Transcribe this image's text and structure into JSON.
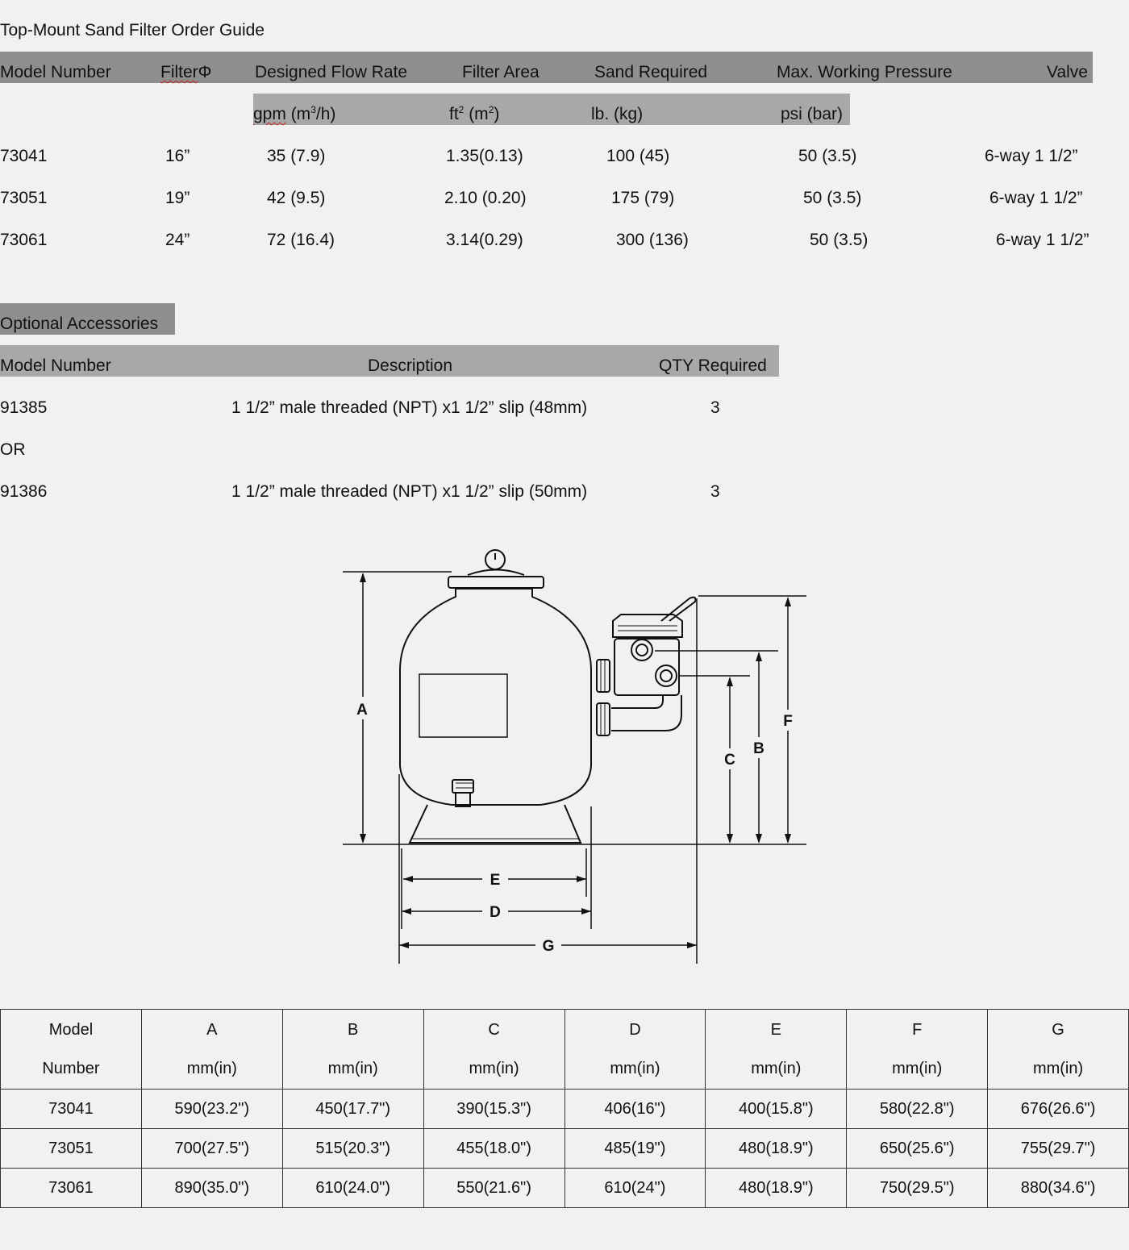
{
  "order_guide": {
    "title": "Top-Mount Sand Filter Order Guide",
    "headers": {
      "model": "Model Number",
      "filter": "Filter",
      "filter_symbol": "Φ",
      "flow": "Designed Flow Rate",
      "area": "Filter Area",
      "sand": "Sand Required",
      "pressure": "Max. Working Pressure",
      "valve": "Valve"
    },
    "units": {
      "flow_a": "gpm",
      "flow_b": " (m",
      "flow_sup": "3",
      "flow_c": "/h)",
      "area_a": "ft",
      "area_sup1": "2",
      "area_b": " (m",
      "area_sup2": "2",
      "area_c": ")",
      "sand": "lb. (kg)",
      "pressure": "psi (bar)"
    },
    "rows": [
      {
        "model": "73041",
        "filter": "16”",
        "flow": "35 (7.9)",
        "area": "1.35(0.13)",
        "sand": "100 (45)",
        "pressure": "50 (3.5)",
        "valve": "6-way 1 1/2”"
      },
      {
        "model": "73051",
        "filter": "19”",
        "flow": "42 (9.5)",
        "area": "2.10 (0.20)",
        "sand": "175 (79)",
        "pressure": "50 (3.5)",
        "valve": "6-way 1 1/2”"
      },
      {
        "model": "73061",
        "filter": "24”",
        "flow": "72 (16.4)",
        "area": "3.14(0.29)",
        "sand": "300 (136)",
        "pressure": "50 (3.5)",
        "valve": "6-way 1 1/2”"
      }
    ]
  },
  "accessories": {
    "title": "Optional Accessories",
    "headers": {
      "model": "Model Number",
      "description": "Description",
      "qty": "QTY Required"
    },
    "rows": [
      {
        "model": "91385",
        "description": "1 1/2” male threaded (NPT) x1 1/2” slip (48mm)",
        "qty": "3"
      },
      {
        "model": "91386",
        "description": "1 1/2” male threaded (NPT) x1 1/2” slip (50mm)",
        "qty": "3"
      }
    ],
    "or_text": "OR"
  },
  "diagram": {
    "labels": {
      "A": "A",
      "B": "B",
      "C": "C",
      "D": "D",
      "E": "E",
      "F": "F",
      "G": "G"
    }
  },
  "dimensions_table": {
    "header_top": [
      "Model",
      "A",
      "B",
      "C",
      "D",
      "E",
      "F",
      "G"
    ],
    "header_bottom": [
      "Number",
      "mm(in)",
      "mm(in)",
      "mm(in)",
      "mm(in)",
      "mm(in)",
      "mm(in)",
      "mm(in)"
    ],
    "rows": [
      [
        "73041",
        "590(23.2\")",
        "450(17.7\")",
        "390(15.3\")",
        "406(16\")",
        "400(15.8\")",
        "580(22.8\")",
        "676(26.6\")"
      ],
      [
        "73051",
        "700(27.5\")",
        "515(20.3\")",
        "455(18.0\")",
        "485(19\")",
        "480(18.9\")",
        "650(25.6\")",
        "755(29.7\")"
      ],
      [
        "73061",
        "890(35.0\")",
        "610(24.0\")",
        "550(21.6\")",
        "610(24\")",
        "480(18.9\")",
        "750(29.5\")",
        "880(34.6\")"
      ]
    ]
  }
}
